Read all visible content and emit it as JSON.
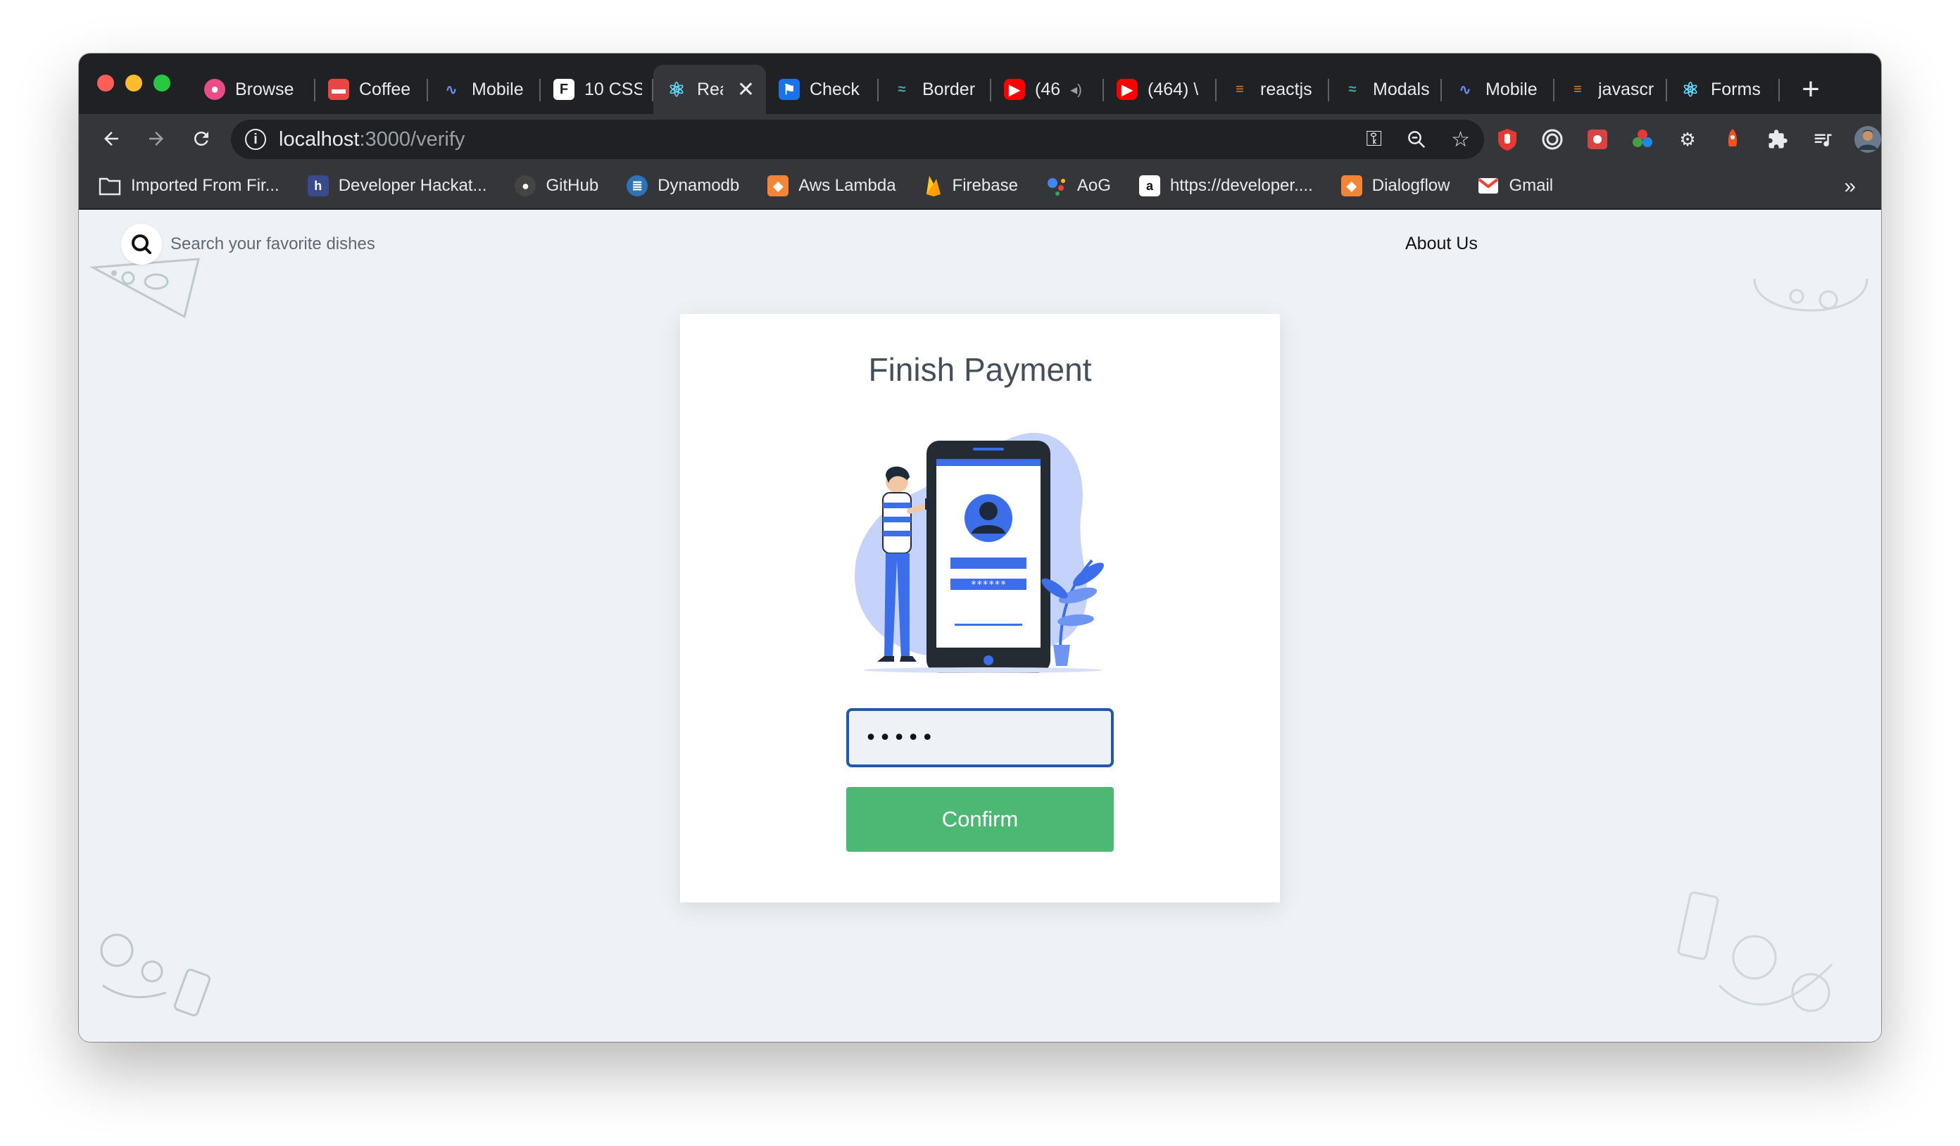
{
  "browser": {
    "tabs": [
      {
        "label": "Browse",
        "icon": "dribbble-icon",
        "color": "#ea4c89"
      },
      {
        "label": "Coffee",
        "icon": "coffee-site-icon",
        "color": "#e84545"
      },
      {
        "label": "Mobile",
        "icon": "wave-icon",
        "color": "#1a3c8f"
      },
      {
        "label": "10 CSS",
        "icon": "f-logo-icon",
        "color": "#ffffff"
      },
      {
        "label": "Rea",
        "icon": "react-icon",
        "color": "#61dafb",
        "active": true
      },
      {
        "label": "Check",
        "icon": "flag-icon",
        "color": "#1a73e8"
      },
      {
        "label": "Border",
        "icon": "tailwind-icon",
        "color": "#38b2ac"
      },
      {
        "label": "(46",
        "icon": "youtube-icon",
        "color": "#ff0000"
      },
      {
        "label": "(464) \\",
        "icon": "youtube-icon",
        "color": "#ff0000"
      },
      {
        "label": "reactjs",
        "icon": "stackoverflow-icon",
        "color": "#f48024"
      },
      {
        "label": "Modals",
        "icon": "tailwind-icon",
        "color": "#38b2ac"
      },
      {
        "label": "Mobile",
        "icon": "wave-icon",
        "color": "#1a3c8f"
      },
      {
        "label": "javascr",
        "icon": "stackoverflow-icon",
        "color": "#f48024"
      },
      {
        "label": "Forms",
        "icon": "react-icon",
        "color": "#61dafb"
      }
    ],
    "new_tab": "+",
    "address": {
      "host": "localhost",
      "rest": ":3000/verify"
    },
    "bookmarks": [
      {
        "label": "Imported From Fir...",
        "icon": "folder-icon",
        "color": "#9aa0a6"
      },
      {
        "label": "Developer Hackat...",
        "icon": "hackathon-icon",
        "color": "#3b4a8c"
      },
      {
        "label": "GitHub",
        "icon": "github-icon",
        "color": "#24292e"
      },
      {
        "label": "Dynamodb",
        "icon": "dynamodb-icon",
        "color": "#2e73b8"
      },
      {
        "label": "Aws Lambda",
        "icon": "aws-cube-icon",
        "color": "#f58536"
      },
      {
        "label": "Firebase",
        "icon": "firebase-icon",
        "color": "#ffca28"
      },
      {
        "label": "AoG",
        "icon": "google-assistant-icon",
        "color": "#4285f4"
      },
      {
        "label": "https://developer....",
        "icon": "amazon-icon",
        "color": "#ffffff"
      },
      {
        "label": "Dialogflow",
        "icon": "aws-cube-icon",
        "color": "#f58536"
      },
      {
        "label": "Gmail",
        "icon": "gmail-icon",
        "color": "#ea4335"
      }
    ],
    "bookmarks_more": "»"
  },
  "page": {
    "search_placeholder": "Search your favorite dishes",
    "about_label": "About Us",
    "card": {
      "title": "Finish Payment",
      "otp_value": "•••••",
      "phone_password": "******",
      "confirm_label": "Confirm"
    }
  },
  "colors": {
    "accent_blue": "#3b6ee8",
    "confirm_green": "#4cb874",
    "page_bg": "#eef2f6"
  }
}
